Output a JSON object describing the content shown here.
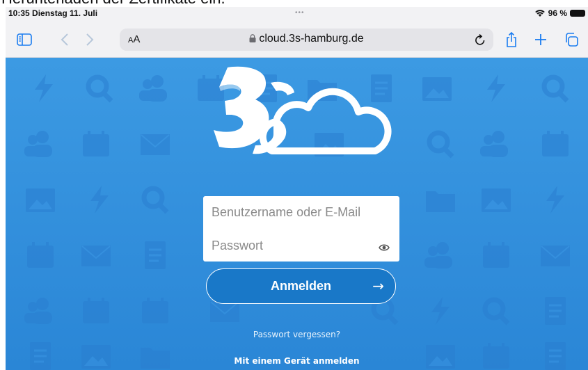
{
  "document": {
    "caption": "Herunterladen der Zertifikate ein."
  },
  "status_bar": {
    "time_date": "10:35  Dienstag 11. Juli",
    "battery_percent": "96 %",
    "dots": "•••"
  },
  "toolbar": {
    "text_size_small": "A",
    "text_size_big": "A",
    "url": "cloud.3s-hamburg.de",
    "icons": [
      "sidebar-icon",
      "back-icon",
      "forward-icon",
      "lock-icon",
      "reload-icon",
      "share-icon",
      "new-tab-icon",
      "tabs-icon"
    ]
  },
  "login": {
    "username_placeholder": "Benutzername oder E-Mail",
    "password_placeholder": "Passwort",
    "submit_label": "Anmelden",
    "submit_arrow": "→",
    "forgot_link": "Passwort vergessen?",
    "device_link": "Mit einem Gerät anmelden"
  },
  "colors": {
    "page_background": "#2f8edc",
    "button": "#1978c8",
    "white": "#ffffff"
  }
}
